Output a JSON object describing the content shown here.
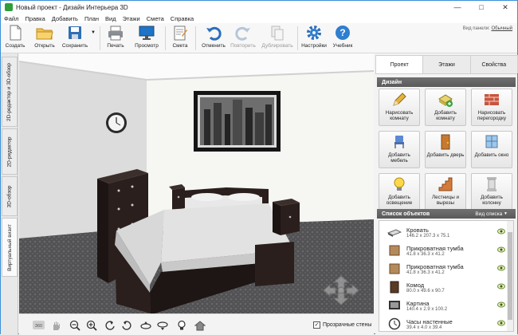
{
  "window": {
    "title": "Новый проект - Дизайн Интерьера 3D"
  },
  "menu": [
    "Файл",
    "Правка",
    "Добавить",
    "План",
    "Вид",
    "Этажи",
    "Смета",
    "Справка"
  ],
  "toolbar": {
    "create": "Создать",
    "open": "Открыть",
    "save": "Сохранить",
    "print": "Печать",
    "preview": "Просмотр",
    "estimate": "Смета",
    "undo": "Отменить",
    "redo": "Повторить",
    "duplicate": "Дублировать",
    "settings": "Настройки",
    "tutorial": "Учебник",
    "panel_view_label": "Вид панели:",
    "panel_view_value": "Обычный"
  },
  "vtabs": [
    "2D-редактор и 3D-обзор",
    "2D-редактор",
    "3D-обзор",
    "Виртуальный визит"
  ],
  "viewbar": {
    "transparent_walls": "Прозрачные стены",
    "transparent_checked": true
  },
  "rpanel": {
    "tabs": [
      "Проект",
      "Этажи",
      "Свойства"
    ],
    "active_tab": 0,
    "design_header": "Дизайн",
    "design_buttons": [
      {
        "label": "Нарисовать комнату",
        "icon": "pencil-icon"
      },
      {
        "label": "Добавить комнату",
        "icon": "room-icon"
      },
      {
        "label": "Нарисовать перегородку",
        "icon": "brick-wall-icon"
      },
      {
        "label": "Добавить мебель",
        "icon": "chair-icon"
      },
      {
        "label": "Добавить дверь",
        "icon": "door-icon"
      },
      {
        "label": "Добавить окно",
        "icon": "window-icon"
      },
      {
        "label": "Добавить освещение",
        "icon": "bulb-icon"
      },
      {
        "label": "Лестницы и вырезы",
        "icon": "stairs-icon"
      },
      {
        "label": "Добавить колонну",
        "icon": "column-icon"
      }
    ],
    "list_header": "Список объектов",
    "list_view": "Вид списка",
    "objects": [
      {
        "name": "Кровать",
        "dims": "146.2 x 207.3 x 75.1"
      },
      {
        "name": "Прикроватная тумба",
        "dims": "41.8 x 36.3 x 41.2"
      },
      {
        "name": "Прикроватная тумба",
        "dims": "41.8 x 36.3 x 41.2"
      },
      {
        "name": "Комод",
        "dims": "80.0 x 49.6 x 90.7"
      },
      {
        "name": "Картина",
        "dims": "140.4 x 2.9 x 100.2"
      },
      {
        "name": "Часы настенные",
        "dims": "39.4 x 4.0 x 39.4"
      }
    ]
  },
  "colors": {
    "accent": "#3b8fd9",
    "header_gray": "#606060",
    "furniture": "#2a1f1c",
    "floor": "#5c5c5e"
  }
}
